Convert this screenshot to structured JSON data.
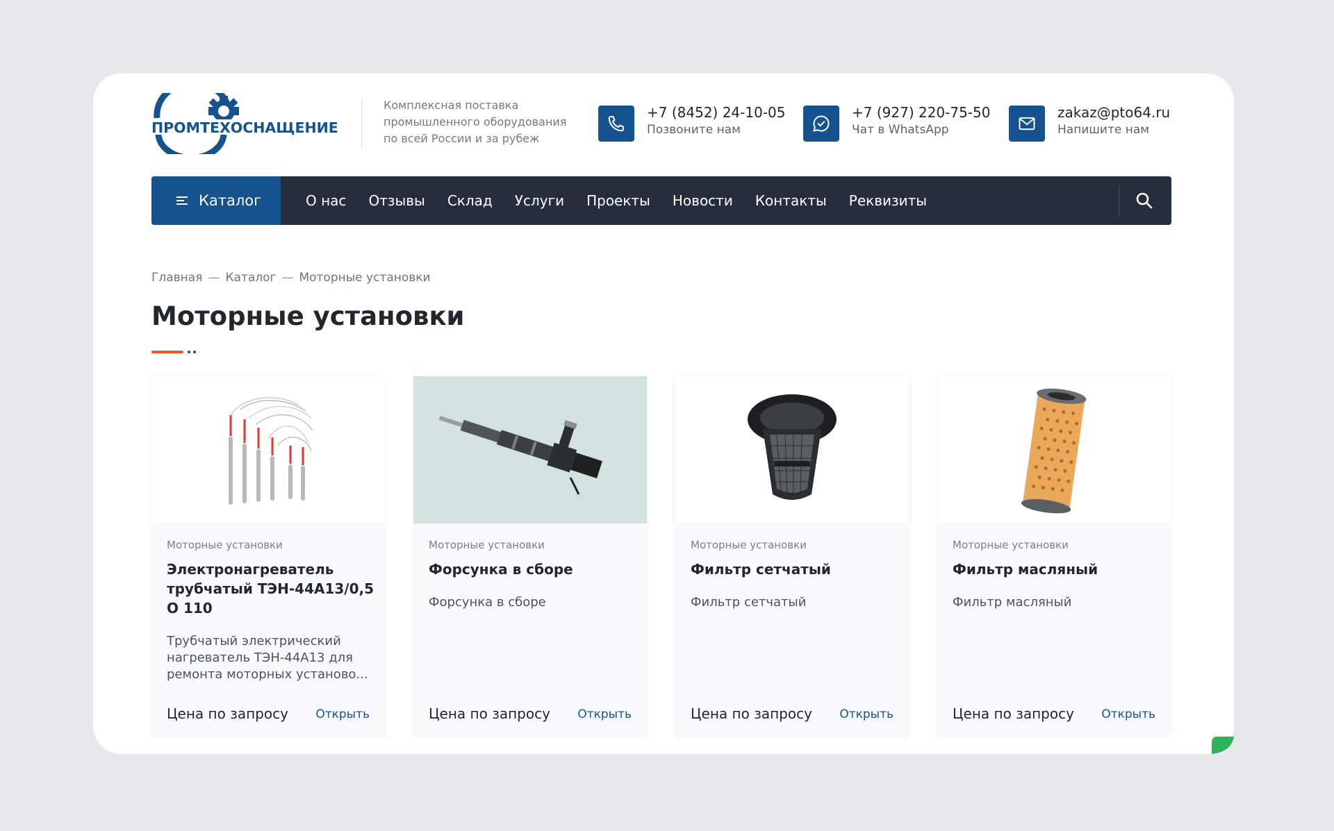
{
  "header": {
    "logo_text": "ПРОМТЕХОСНАЩЕНИЕ",
    "tagline": [
      "Комплексная поставка",
      "промышленного оборудования",
      "по всей России и за рубеж"
    ],
    "contacts": [
      {
        "icon": "phone-icon",
        "main": "+7 (8452) 24-10-05",
        "sub": "Позвоните нам"
      },
      {
        "icon": "whatsapp-icon",
        "main": "+7 (927) 220-75-50",
        "sub": "Чат в WhatsApp"
      },
      {
        "icon": "mail-icon",
        "main": "zakaz@pto64.ru",
        "sub": "Напишите нам"
      }
    ]
  },
  "nav": {
    "catalog_label": "Каталог",
    "links": [
      "О нас",
      "Отзывы",
      "Склад",
      "Услуги",
      "Проекты",
      "Новости",
      "Контакты",
      "Реквизиты"
    ],
    "search_icon": "search-icon"
  },
  "breadcrumb": {
    "items": [
      "Главная",
      "Каталог",
      "Моторные установки"
    ],
    "separator": "—"
  },
  "page": {
    "title": "Моторные установки"
  },
  "products": [
    {
      "category": "Моторные установки",
      "name": "Электронагреватель трубчатый ТЭН-44А13/0,5 О 110",
      "description": "Трубчатый электрический нагреватель ТЭН-44А13 для ремонта моторных установо...",
      "price": "Цена по запросу",
      "action": "Открыть",
      "image_icon": "heating-element-icon"
    },
    {
      "category": "Моторные установки",
      "name": "Форсунка в сборе",
      "description": "Форсунка в сборе",
      "price": "Цена по запросу",
      "action": "Открыть",
      "image_icon": "injector-icon"
    },
    {
      "category": "Моторные установки",
      "name": "Фильтр сетчатый",
      "description": "Фильтр сетчатый",
      "price": "Цена по запросу",
      "action": "Открыть",
      "image_icon": "mesh-filter-icon"
    },
    {
      "category": "Моторные установки",
      "name": "Фильтр масляный",
      "description": "Фильтр масляный",
      "price": "Цена по запросу",
      "action": "Открыть",
      "image_icon": "oil-filter-icon"
    }
  ],
  "colors": {
    "brand_blue": "#16538e",
    "nav_dark": "#262d3d",
    "accent_orange": "#ee5a24",
    "background": "#e8e8ef",
    "badge_green": "#2eb35a"
  }
}
